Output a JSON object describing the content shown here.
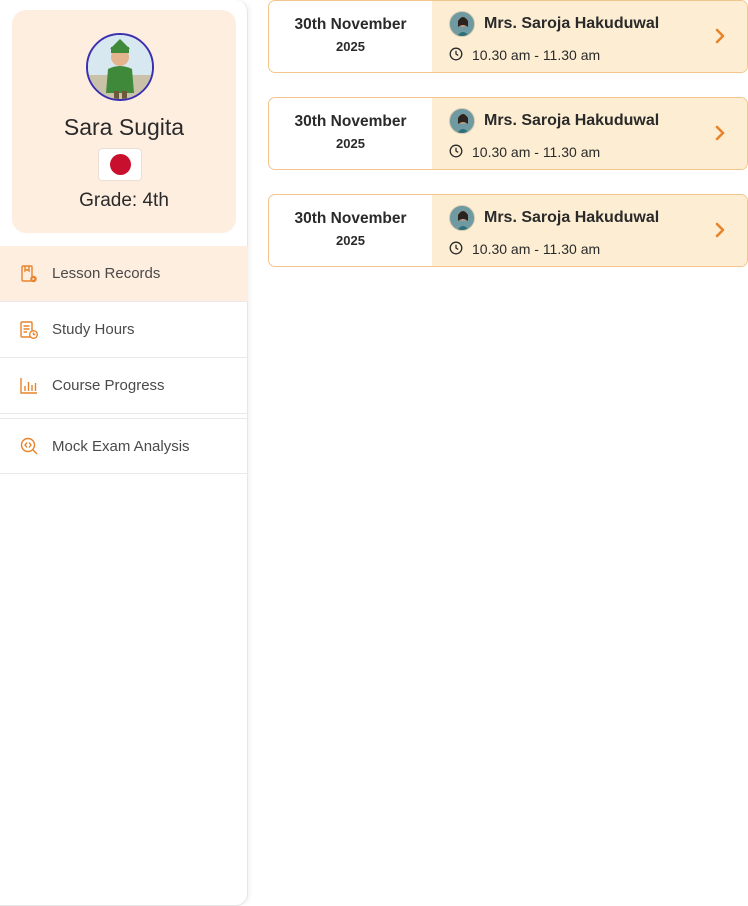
{
  "student": {
    "name": "Sara Sugita",
    "grade": "Grade: 4th",
    "flag_icon": "japan-flag-icon",
    "avatar_border_color": "#3b2fb0"
  },
  "menu": [
    {
      "label": "Lesson Records",
      "icon": "lesson-records-icon",
      "active": true
    },
    {
      "label": "Study Hours",
      "icon": "study-hours-icon",
      "active": false
    },
    {
      "label": "Course Progress",
      "icon": "course-progress-icon",
      "active": false
    },
    {
      "label": "Mock Exam Analysis",
      "icon": "mock-exam-icon",
      "active": false
    }
  ],
  "lessons": [
    {
      "date": "30th November",
      "year": "2025",
      "teacher": "Mrs. Saroja Hakuduwal",
      "time": "10.30 am - 11.30 am"
    },
    {
      "date": "30th November",
      "year": "2025",
      "teacher": "Mrs. Saroja Hakuduwal",
      "time": "10.30 am - 11.30 am"
    },
    {
      "date": "30th November",
      "year": "2025",
      "teacher": "Mrs. Saroja Hakuduwal",
      "time": "10.30 am - 11.30 am"
    }
  ],
  "colors": {
    "accent": "#e8832a",
    "card_bg": "#fdeee0",
    "lesson_info_bg": "#fdeed3",
    "lesson_border": "#f2c58a"
  }
}
